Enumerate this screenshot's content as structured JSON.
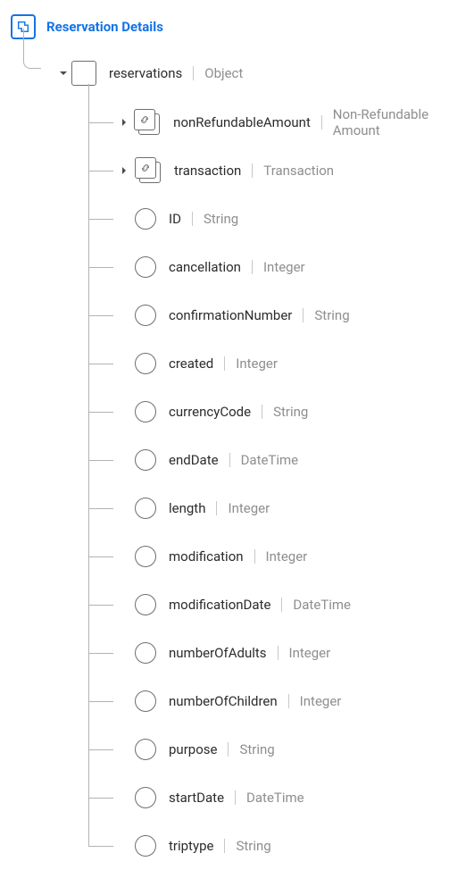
{
  "root": {
    "title": "Reservation Details"
  },
  "l1": {
    "name": "reservations",
    "type": "Object"
  },
  "children": [
    {
      "name": "nonRefundableAmount",
      "type": "Non-Refundable Amount",
      "icon": "stack",
      "expandable": true
    },
    {
      "name": "transaction",
      "type": "Transaction",
      "icon": "stack",
      "expandable": true
    },
    {
      "name": "ID",
      "type": "String",
      "icon": "circle",
      "expandable": false
    },
    {
      "name": "cancellation",
      "type": "Integer",
      "icon": "circle",
      "expandable": false
    },
    {
      "name": "confirmationNumber",
      "type": "String",
      "icon": "circle",
      "expandable": false
    },
    {
      "name": "created",
      "type": "Integer",
      "icon": "circle",
      "expandable": false
    },
    {
      "name": "currencyCode",
      "type": "String",
      "icon": "circle",
      "expandable": false
    },
    {
      "name": "endDate",
      "type": "DateTime",
      "icon": "circle",
      "expandable": false
    },
    {
      "name": "length",
      "type": "Integer",
      "icon": "circle",
      "expandable": false
    },
    {
      "name": "modification",
      "type": "Integer",
      "icon": "circle",
      "expandable": false
    },
    {
      "name": "modificationDate",
      "type": "DateTime",
      "icon": "circle",
      "expandable": false
    },
    {
      "name": "numberOfAdults",
      "type": "Integer",
      "icon": "circle",
      "expandable": false
    },
    {
      "name": "numberOfChildren",
      "type": "Integer",
      "icon": "circle",
      "expandable": false
    },
    {
      "name": "purpose",
      "type": "String",
      "icon": "circle",
      "expandable": false
    },
    {
      "name": "startDate",
      "type": "DateTime",
      "icon": "circle",
      "expandable": false
    },
    {
      "name": "triptype",
      "type": "String",
      "icon": "circle",
      "expandable": false
    }
  ]
}
